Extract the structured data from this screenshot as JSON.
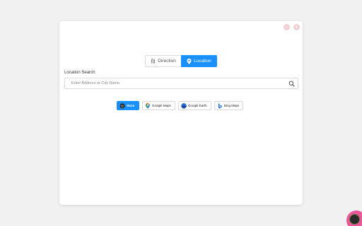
{
  "window_controls": {
    "minimize_symbol": "–",
    "close_symbol": "×"
  },
  "mode_toggle": {
    "direction_label": "Direction",
    "location_label": "Location",
    "selected": "location"
  },
  "search": {
    "label": "Location Search:",
    "value": "",
    "placeholder": "Enter Address or City Name"
  },
  "map_providers": [
    {
      "label": "Waze",
      "icon": "waze-icon",
      "active": true
    },
    {
      "label": "Google Maps",
      "icon": "google-maps-icon",
      "active": false
    },
    {
      "label": "Google Earth",
      "icon": "google-earth-icon",
      "active": false
    },
    {
      "label": "Bing Maps",
      "icon": "bing-icon",
      "active": false
    }
  ],
  "colors": {
    "accent": "#1890ff",
    "window_button": "#f0cfd3",
    "fab": "#e8589a"
  }
}
